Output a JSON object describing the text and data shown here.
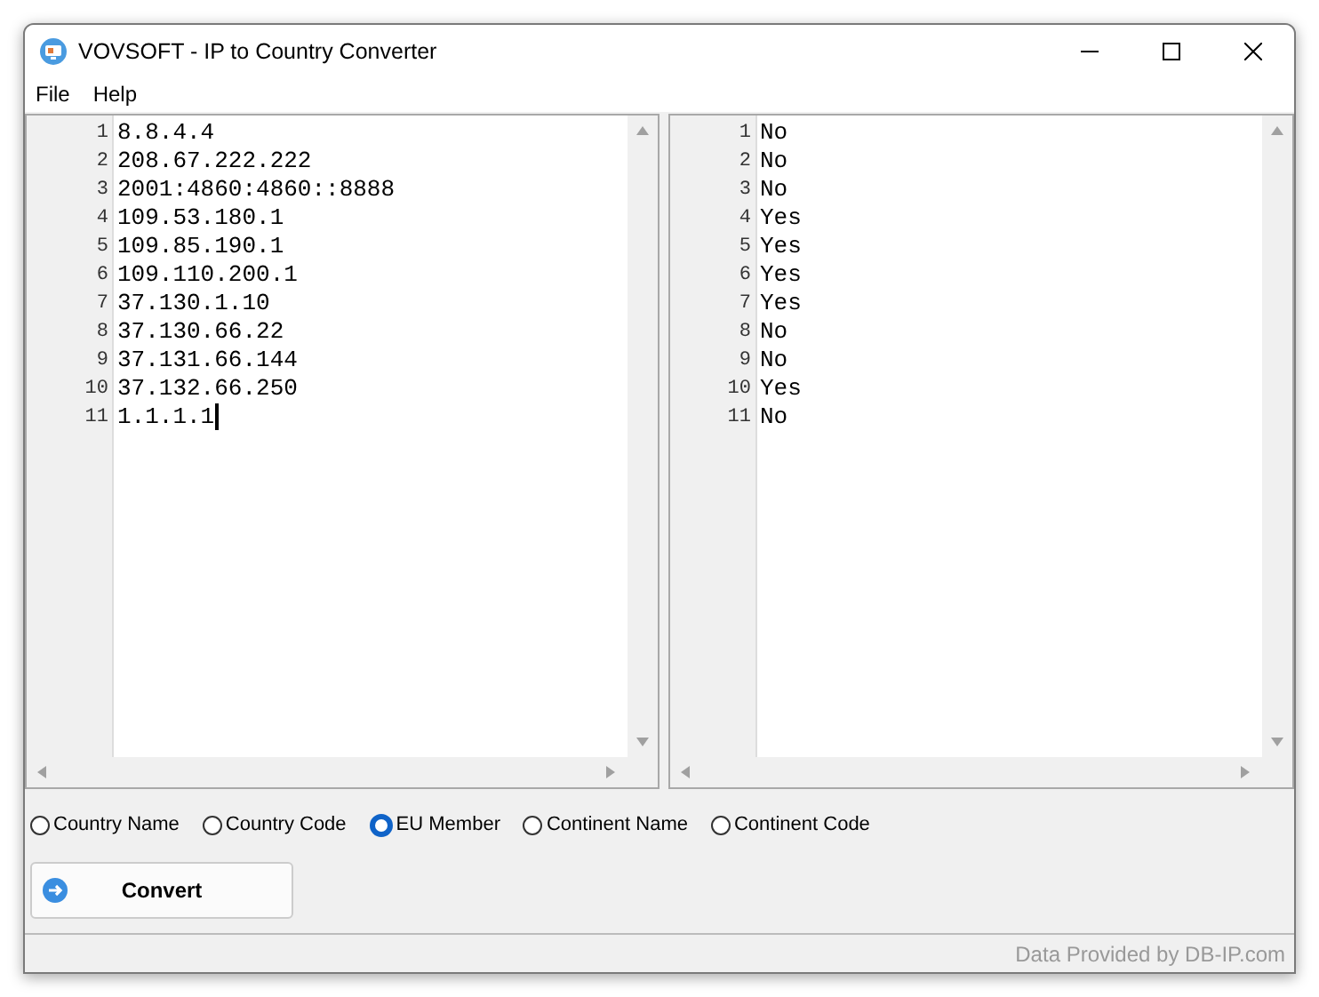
{
  "window": {
    "title": "VOVSOFT - IP to Country Converter"
  },
  "menu": [
    "File",
    "Help"
  ],
  "input_editor": {
    "lines": [
      {
        "number": "1",
        "text": "8.8.4.4",
        "caret": false
      },
      {
        "number": "2",
        "text": "208.67.222.222",
        "caret": false
      },
      {
        "number": "3",
        "text": "2001:4860:4860::8888",
        "caret": false
      },
      {
        "number": "4",
        "text": "109.53.180.1",
        "caret": false
      },
      {
        "number": "5",
        "text": "109.85.190.1",
        "caret": false
      },
      {
        "number": "6",
        "text": "109.110.200.1",
        "caret": false
      },
      {
        "number": "7",
        "text": "37.130.1.10",
        "caret": false
      },
      {
        "number": "8",
        "text": "37.130.66.22",
        "caret": false
      },
      {
        "number": "9",
        "text": "37.131.66.144",
        "caret": false
      },
      {
        "number": "10",
        "text": "37.132.66.250",
        "caret": false
      },
      {
        "number": "11",
        "text": "1.1.1.1",
        "caret": true
      }
    ]
  },
  "output_editor": {
    "lines": [
      {
        "number": "1",
        "text": "No"
      },
      {
        "number": "2",
        "text": "No"
      },
      {
        "number": "3",
        "text": "No"
      },
      {
        "number": "4",
        "text": "Yes"
      },
      {
        "number": "5",
        "text": "Yes"
      },
      {
        "number": "6",
        "text": "Yes"
      },
      {
        "number": "7",
        "text": "Yes"
      },
      {
        "number": "8",
        "text": "No"
      },
      {
        "number": "9",
        "text": "No"
      },
      {
        "number": "10",
        "text": "Yes"
      },
      {
        "number": "11",
        "text": "No"
      }
    ]
  },
  "output_options": [
    {
      "label": "Country Name",
      "selected": false
    },
    {
      "label": "Country Code",
      "selected": false
    },
    {
      "label": "EU Member",
      "selected": true
    },
    {
      "label": "Continent Name",
      "selected": false
    },
    {
      "label": "Continent Code",
      "selected": false
    }
  ],
  "convert_button": {
    "label": "Convert"
  },
  "status_bar": {
    "text": "Data Provided by DB-IP.com"
  }
}
